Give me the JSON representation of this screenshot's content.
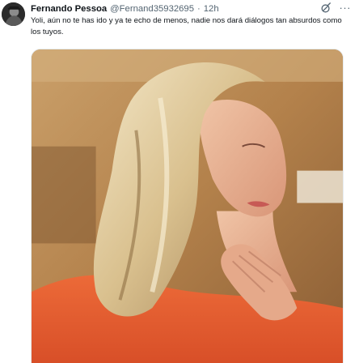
{
  "tweet": {
    "author_name": "Fernando Pessoa",
    "author_handle": "@Fernand35932695",
    "separator": "·",
    "time": "12h",
    "more_label": "···",
    "text": "Yoli, aún no te has ido y ya te echo de menos, nadie nos dará diálogos tan absurdos como los tuyos.",
    "media": {
      "kind": "photo",
      "subject": "woman with blonde hair in profile, hand at neck, orange top"
    }
  },
  "icons": {
    "avatar": "avatar-photo",
    "grok": "grok-icon",
    "more": "more-icon"
  },
  "colors": {
    "text_primary": "#0f1419",
    "text_secondary": "#536471",
    "top_orange": "#e2592e",
    "background_wood": "#b98a55"
  }
}
